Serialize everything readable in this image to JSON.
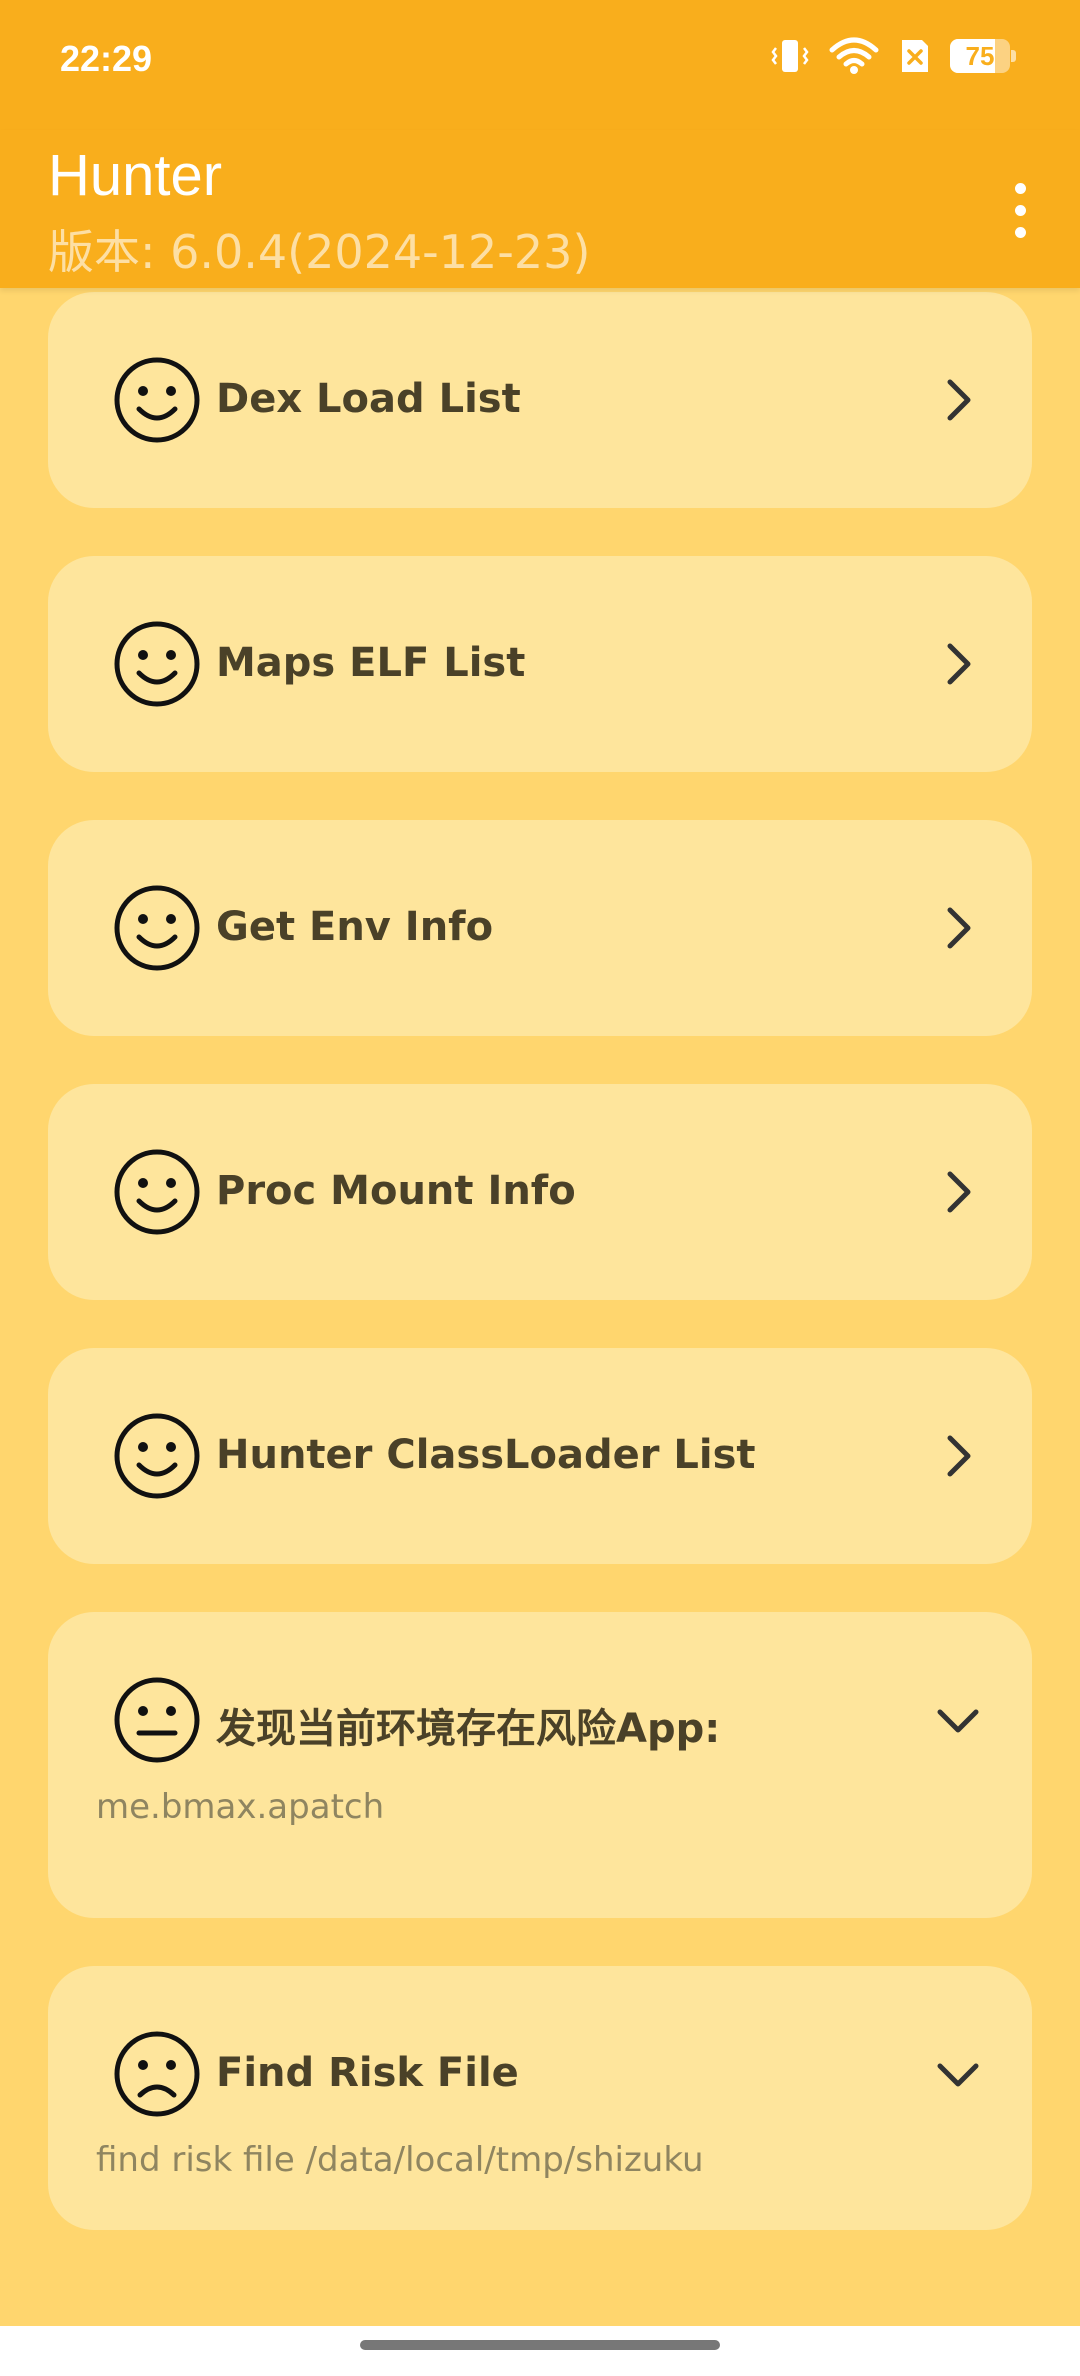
{
  "status_bar": {
    "time": "22:29",
    "battery": "75"
  },
  "app_bar": {
    "title": "Hunter",
    "subtitle": "版本: 6.0.4(2024-12-23)"
  },
  "cards": [
    {
      "title": "Dex Load List",
      "icon": "smile-icon",
      "chevron": "chevron-right-icon"
    },
    {
      "title": "Maps ELF List",
      "icon": "smile-icon",
      "chevron": "chevron-right-icon"
    },
    {
      "title": "Get Env Info",
      "icon": "smile-icon",
      "chevron": "chevron-right-icon"
    },
    {
      "title": "Proc Mount Info",
      "icon": "smile-icon",
      "chevron": "chevron-right-icon"
    },
    {
      "title": "Hunter ClassLoader List",
      "icon": "smile-icon",
      "chevron": "chevron-right-icon"
    },
    {
      "title": "发现当前环境存在风险App:",
      "detail": "me.bmax.apatch",
      "icon": "neutral-face-icon",
      "chevron": "chevron-down-icon"
    },
    {
      "title": "Find Risk File",
      "detail": "find risk file /data/local/tmp/shizuku",
      "icon": "sad-face-icon",
      "chevron": "chevron-down-icon"
    }
  ],
  "colors": {
    "app_bar": "#F9AE1C",
    "background": "#FFD66E",
    "card": "#FEE59C",
    "card_text": "#4A4128"
  }
}
